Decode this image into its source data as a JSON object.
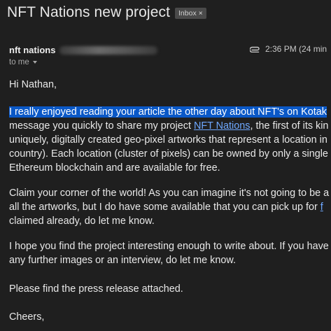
{
  "email": {
    "subject": "NFT Nations new project",
    "label_chip": "Inbox",
    "label_chip_close": "×",
    "sender_name": "nft nations",
    "time": "2:36 PM (24 min",
    "recipient": "to me",
    "greeting": "Hi Nathan,",
    "paragraph1": {
      "line1_highlighted": "I really enjoyed reading your article the other day about NFT's on Kotak",
      "line2_before": "message you quickly to share my project ",
      "line2_link": "NFT Nations",
      "line2_after": ", the first of its kin",
      "line3": "uniquely, digitally created geo-pixel artworks that represent a location in",
      "line4": "country). Each location (cluster of pixels) can be owned by only a single",
      "line5": "Ethereum blockchain and are available for free."
    },
    "paragraph2": {
      "line1": "Claim your corner of the world! As you can imagine it's not going to be a",
      "line2_before": "all the artworks, but I do have some available that you can pick up for ",
      "line2_link": "f",
      "line3": "claimed already, do let me know."
    },
    "paragraph3": {
      "line1": "I hope you find the project interesting enough to write about. If you have",
      "line2": "any further images or an interview, do let me know."
    },
    "paragraph4": "Please find the press release attached.",
    "closing": "Cheers,"
  },
  "icons": {
    "attachment": "paperclip-icon",
    "recipient_details": "chevron-down-icon",
    "remove_label": "close-icon"
  },
  "colors": {
    "background": "#1f1f1f",
    "text": "#e8e8e8",
    "selection": "#0a58c7",
    "link": "#6ea8ff",
    "chip": "#4a4a4a"
  }
}
